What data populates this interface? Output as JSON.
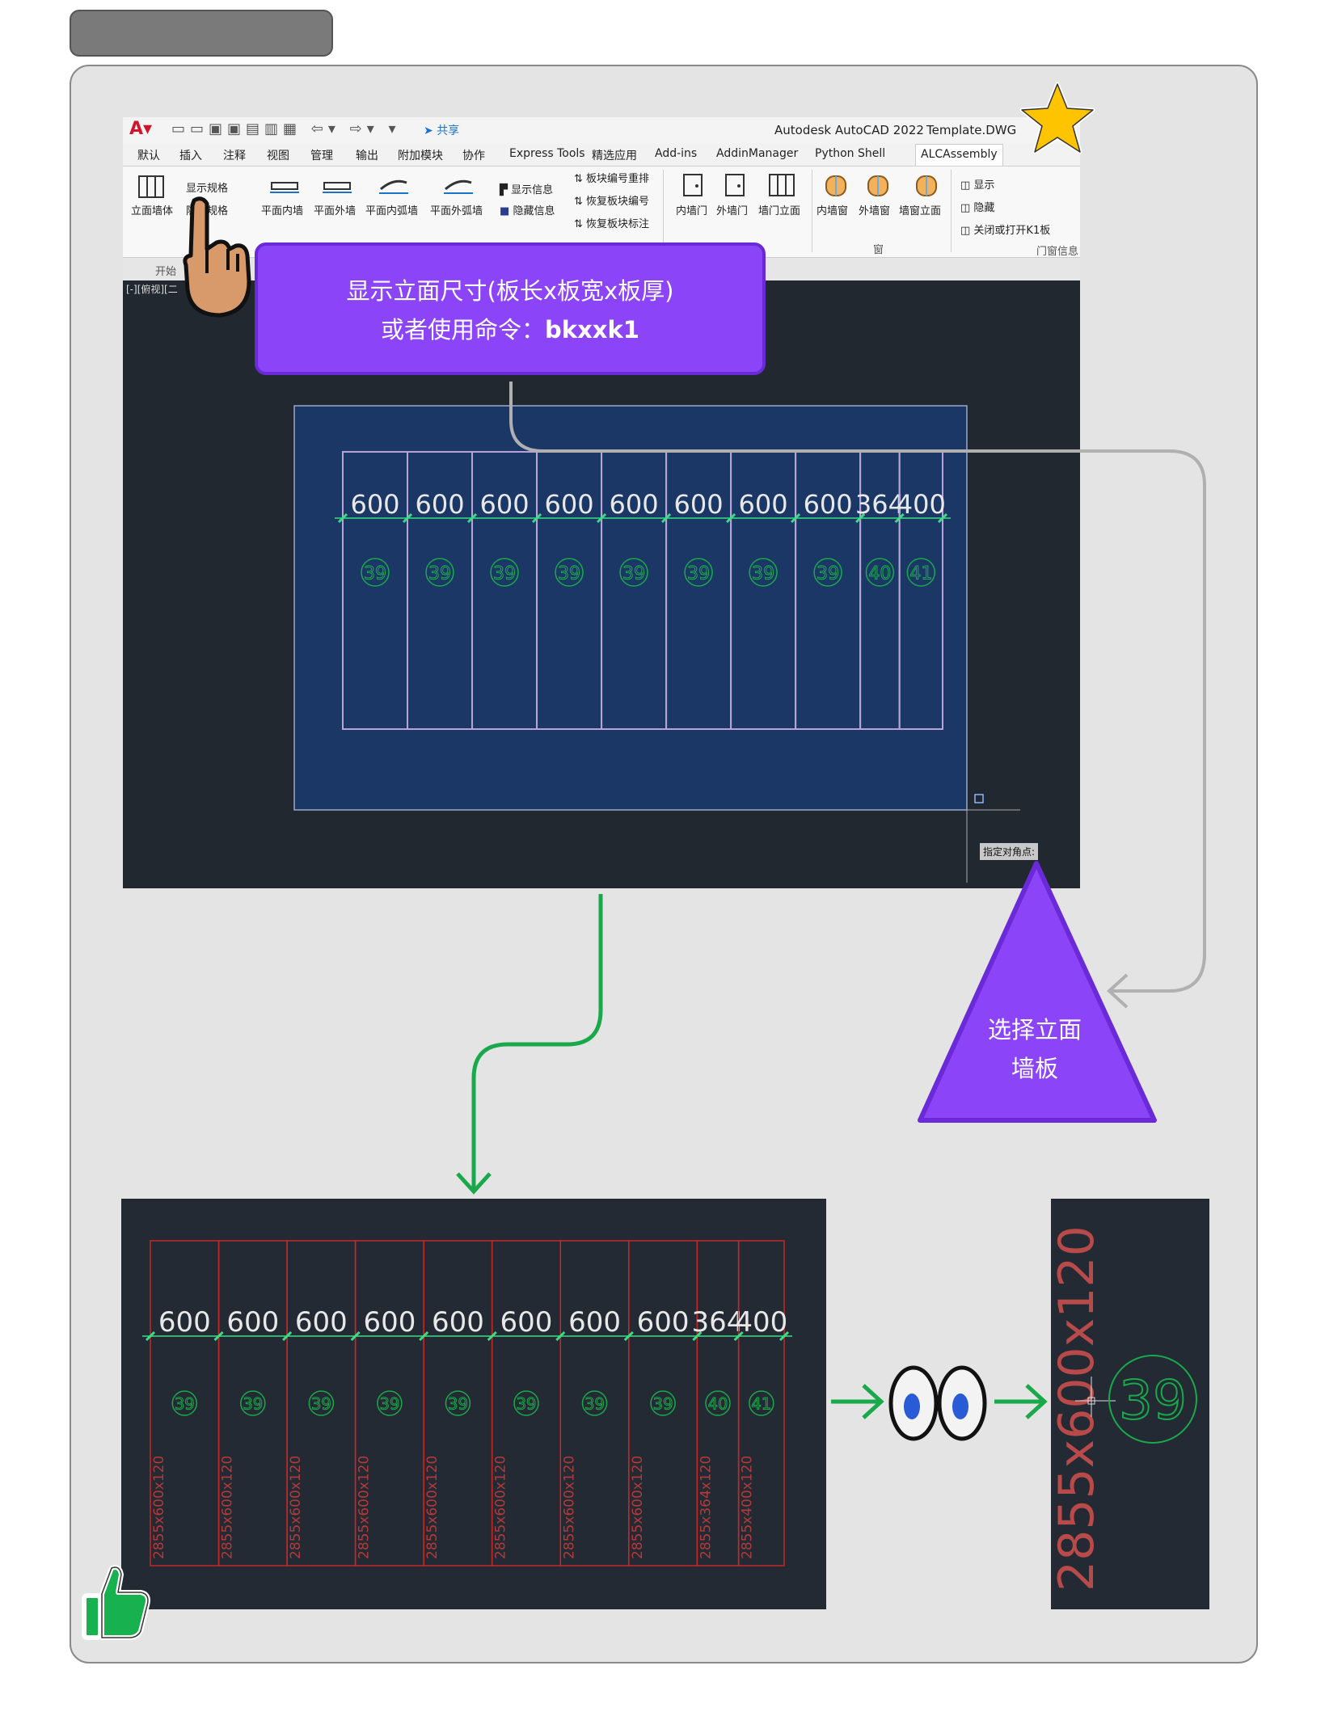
{
  "window": {
    "app_title": "Autodesk AutoCAD 2022",
    "file_name": "Template.DWG",
    "share_label": "共享"
  },
  "menu": [
    "默认",
    "插入",
    "注释",
    "视图",
    "管理",
    "输出",
    "附加模块",
    "协作",
    "Express Tools",
    "精选应用",
    "Add-ins",
    "AddinManager",
    "Python Shell",
    "ALCAssembly"
  ],
  "ribbon": {
    "vertical_wall": "立面墙体",
    "show_spec": "显示规格",
    "hide_spec": "隐藏规格",
    "plan_inner_wall": "平面内墙",
    "plan_outer_wall": "平面外墙",
    "plan_inner_arc_wall": "平面内弧墙",
    "plan_outer_arc_wall": "平面外弧墙",
    "show_info": "显示信息",
    "hide_info": "隐藏信息",
    "renumber_panels": "板块编号重排",
    "restore_panel_number": "恢复板块编号",
    "restore_panel_label": "恢复板块标注",
    "inner_door": "内墙门",
    "outer_door": "外墙门",
    "door_elevation": "墙门立面",
    "inner_window": "内墙窗",
    "outer_window": "外墙窗",
    "window_elevation": "墙窗立面",
    "window_group": "窗",
    "show": "显示",
    "hide": "隐藏",
    "toggle_k1": "关闭或打开K1板",
    "door_window_info": "门窗信息"
  },
  "tabrow": {
    "start_tab": "开始"
  },
  "viewport": {
    "view_label": "[-][俯视][二",
    "prompt": "指定对角点:"
  },
  "callout": {
    "line1": "显示立面尺寸(板长x板宽x板厚)",
    "line2_prefix": "或者使用命令：",
    "line2_cmd": "bkxxk1"
  },
  "triangle": {
    "line1": "选择立面",
    "line2": "墙板"
  },
  "panels": [
    {
      "width": 600,
      "id": "39"
    },
    {
      "width": 600,
      "id": "39"
    },
    {
      "width": 600,
      "id": "39"
    },
    {
      "width": 600,
      "id": "39"
    },
    {
      "width": 600,
      "id": "39"
    },
    {
      "width": 600,
      "id": "39"
    },
    {
      "width": 600,
      "id": "39"
    },
    {
      "width": 600,
      "id": "39"
    },
    {
      "width": 364,
      "id": "40"
    },
    {
      "width": 400,
      "id": "41"
    }
  ],
  "result_specs": [
    "2855x600x120",
    "2855x600x120",
    "2855x600x120",
    "2855x600x120",
    "2855x600x120",
    "2855x600x120",
    "2855x600x120",
    "2855x600x120",
    "2855x364x120",
    "2855x400x120"
  ],
  "zoom": {
    "spec": "2855x600x120",
    "id": "39"
  },
  "colors": {
    "accent_purple": "#8b44f7",
    "dim_green": "#3ddc84",
    "panel_outline": "#b7a3d8",
    "result_red": "#c62828",
    "arrow_green": "#19a94b"
  }
}
